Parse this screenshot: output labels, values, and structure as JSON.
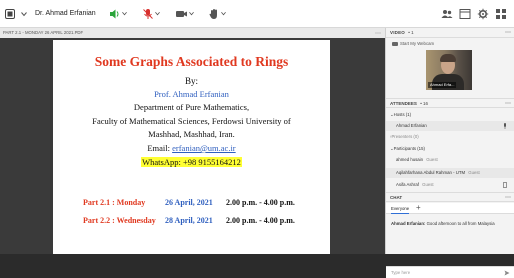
{
  "topbar": {
    "title": "Dr. Ahmad Erfanian",
    "icons": [
      "menu-icon",
      "mic-icon",
      "record-icon",
      "camera-icon",
      "people-icon",
      "chat-icon",
      "hand-icon",
      "settings-icon",
      "more-icon",
      "app-icon"
    ],
    "accent_green": "#2aa43a",
    "accent_red": "#d8302e"
  },
  "document": {
    "header_label": "PART 2.1 - MONDAY 26 APRIL 2021.PDF",
    "title": "Some Graphs Associated to Rings",
    "by": "By:",
    "author": "Prof. Ahmad Erfanian",
    "department": "Department of Pure Mathematics,",
    "faculty_line1": "Faculty of Mathematical Sciences, Ferdowsi University of",
    "faculty_line2": "Mashhad, Mashhad, Iran.",
    "email_label": "Email:",
    "email": "erfanian@um.ac.ir",
    "whatsapp": "WhatsApp: +98 9155164212",
    "part1_label": "Part 2.1 :  Monday",
    "part1_date": "26 April, 2021",
    "part1_time": "2.00 p.m. -  4.00 p.m.",
    "part2_label": "Part 2.2 :  Wednesday",
    "part2_date": "28 April, 2021",
    "part2_time": "2.00 p.m. -  4.00 p.m.",
    "title_color": "#e0381f",
    "accent_color": "#2f5fbf",
    "highlight_color": "#ffff33"
  },
  "video": {
    "header": "VIDEO",
    "count": "1",
    "start_webcam": "Start My Webcam",
    "tile_name": "Ahmad Erfa..."
  },
  "attendees": {
    "header": "ATTENDEES",
    "count": "16",
    "hosts_label": "Hosts (1)",
    "hosts": [
      {
        "name": "Ahmad Erfanian"
      }
    ],
    "presenters_label": "Presenters (0)",
    "participants_label": "Participants (15)",
    "participants": [
      {
        "name": "ahmed husain",
        "role": "Guest"
      },
      {
        "name": "Aqilahfarhana Abdul Rahman - UTM",
        "role": "Guest"
      },
      {
        "name": "Asifa Ashraf",
        "role": "Guest"
      }
    ]
  },
  "chat": {
    "header": "CHAT",
    "tab_everyone": "Everyone",
    "messages": [
      {
        "sender": "Ahmad Erfanian:",
        "text": "Good afternoon to all from Malaysia"
      }
    ],
    "input_placeholder": "Type here"
  }
}
